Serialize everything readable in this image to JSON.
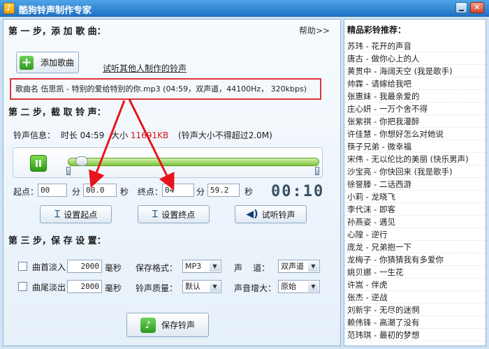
{
  "window": {
    "title": "酷狗铃声制作专家",
    "close_glyph": "✕"
  },
  "step1": {
    "title": "第 一 步，添 加 歌 曲：",
    "help": "帮助>>",
    "add_song_button": "添加歌曲",
    "listen_others_link": "试听其他人制作的铃声",
    "song_info": "歌曲名   伍思凯 - 特别的爱给特别的你.mp3 (04:59，双声道，44100Hz， 320kbps)"
  },
  "step2": {
    "title": "第 二 步，截 取 铃 声：",
    "ring_info_label": "铃声信息：",
    "duration_text": "时长 04:59",
    "size_label": "大小",
    "size_value": "11691KB",
    "size_note": "(铃声大小不得超过2.0M)",
    "progress": 0.02,
    "start_label": "起点：",
    "start_min": "00",
    "min_unit": "分",
    "start_sec": "00.0",
    "sec_unit": "秒",
    "end_label": "终点：",
    "end_min": "04",
    "end_sec": "59.2",
    "lcd_time": "00:10",
    "set_start_button": "设置起点",
    "set_end_button": "设置终点",
    "preview_button": "试听铃声"
  },
  "step3": {
    "title": "第 三 步，保 存 设 置：",
    "fade_in_label": "曲首淡入",
    "fade_in_value": "2000",
    "fade_out_label": "曲尾淡出",
    "fade_out_value": "2000",
    "ms_unit": "毫秒",
    "format_label": "保存格式：",
    "format_value": "MP3",
    "channel_label": "声    道：",
    "channel_value": "双声道",
    "quality_label": "铃声质量：",
    "quality_value": "默认",
    "gain_label": "声音增大：",
    "gain_value": "原始",
    "save_button": "保存铃声"
  },
  "recommend": {
    "title": "精品彩铃推荐：",
    "items": [
      "苏玮 - 花开的声音",
      "唐古 - 做你心上的人",
      "黄贯中 - 海阔天空 (我是歌手)",
      "帅霖 - 请嫁给我吧",
      "张惠妹 - 我最亲爱的",
      "庄心妍 - 一万个舍不得",
      "张紫祺 - 你把我灌醉",
      "许佳慧 - 你想好怎么对她说",
      "筷子兄弟 - 微幸福",
      "宋伟 - 无以伦比的美丽 (快乐男声)",
      "沙宝亮 - 你快回来 (我是歌手)",
      "徐誉滕 - 二话西游",
      "小莉 - 龙晓飞",
      "李代沫 - 即客",
      "孙燕姿 - 遇见",
      "心隍 - 逆行",
      "庞龙 - 兄弟抱一下",
      "龙梅子 - 你猜猜我有多爱你",
      "姚贝娜 - 一生花",
      "许嵩 - 伴虎",
      "张杰 - 逆战",
      "刘新宇 - 无尽的迷惘",
      "赖伟锋 - 高潮了没有",
      "范玮琪 - 最初的梦想"
    ]
  },
  "colors": {
    "highlight_border": "#e0343a",
    "annotation_arrow": "#e8141c",
    "accent_green": "#3aa51f"
  }
}
